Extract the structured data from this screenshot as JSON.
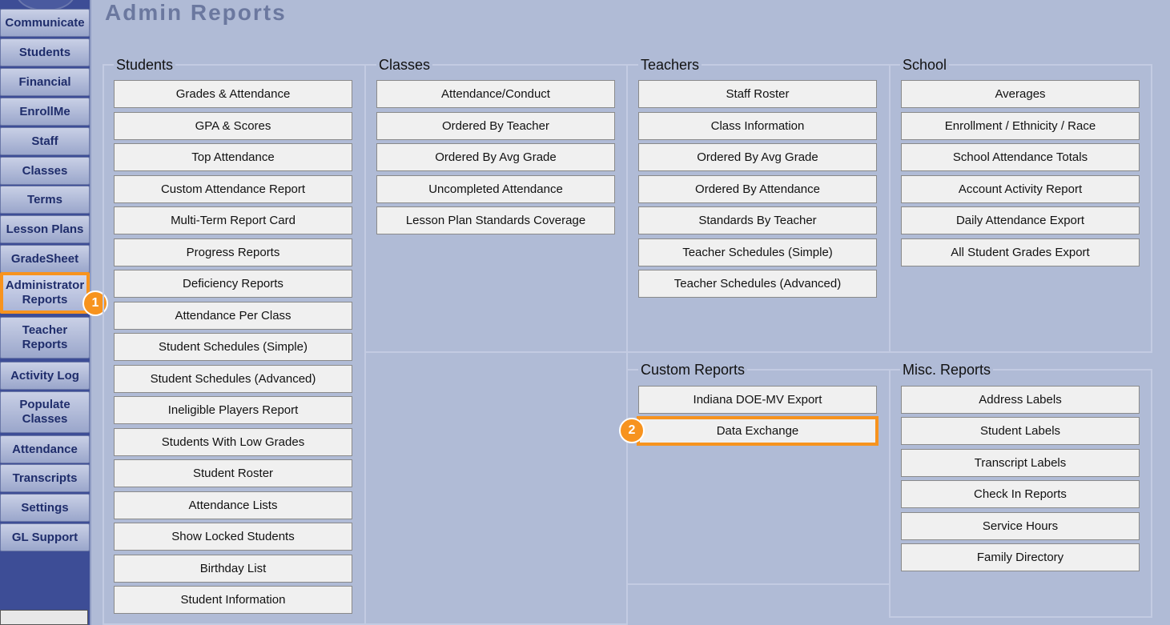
{
  "page": {
    "title": "Admin Reports"
  },
  "sidebar": {
    "items": [
      {
        "label": "Communicate"
      },
      {
        "label": "Students"
      },
      {
        "label": "Financial"
      },
      {
        "label": "EnrollMe"
      },
      {
        "label": "Staff"
      },
      {
        "label": "Classes"
      },
      {
        "label": "Terms"
      },
      {
        "label": "Lesson Plans"
      },
      {
        "label": "GradeSheet"
      },
      {
        "label": "Administrator Reports",
        "active": true
      },
      {
        "label": "Teacher Reports"
      },
      {
        "label": "Activity Log"
      },
      {
        "label": "Populate Classes"
      },
      {
        "label": "Attendance"
      },
      {
        "label": "Transcripts"
      },
      {
        "label": "Settings"
      },
      {
        "label": "GL Support"
      }
    ]
  },
  "badges": {
    "step1": "1",
    "step2": "2",
    "color": "#f7931e"
  },
  "sections": {
    "students": {
      "title": "Students",
      "buttons": [
        "Grades & Attendance",
        "GPA & Scores",
        "Top Attendance",
        "Custom Attendance Report",
        "Multi-Term Report Card",
        "Progress Reports",
        "Deficiency Reports",
        "Attendance Per Class",
        "Student Schedules (Simple)",
        "Student Schedules (Advanced)",
        "Ineligible Players Report",
        "Students With Low Grades",
        "Student Roster",
        "Attendance Lists",
        "Show Locked Students",
        "Birthday List",
        "Student Information"
      ]
    },
    "classes": {
      "title": "Classes",
      "buttons": [
        "Attendance/Conduct",
        "Ordered By Teacher",
        "Ordered By Avg Grade",
        "Uncompleted Attendance",
        "Lesson Plan Standards Coverage"
      ]
    },
    "teachers": {
      "title": "Teachers",
      "buttons": [
        "Staff Roster",
        "Class Information",
        "Ordered By Avg Grade",
        "Ordered By Attendance",
        "Standards By Teacher",
        "Teacher Schedules (Simple)",
        "Teacher Schedules (Advanced)"
      ]
    },
    "school": {
      "title": "School",
      "buttons": [
        "Averages",
        "Enrollment / Ethnicity / Race",
        "School Attendance Totals",
        "Account Activity Report",
        "Daily Attendance Export",
        "All Student Grades Export"
      ]
    },
    "custom": {
      "title": "Custom Reports",
      "buttons": [
        "Indiana DOE-MV Export",
        "Data Exchange"
      ]
    },
    "misc": {
      "title": "Misc. Reports",
      "buttons": [
        "Address Labels",
        "Student Labels",
        "Transcript Labels",
        "Check In Reports",
        "Service Hours",
        "Family Directory"
      ]
    }
  }
}
